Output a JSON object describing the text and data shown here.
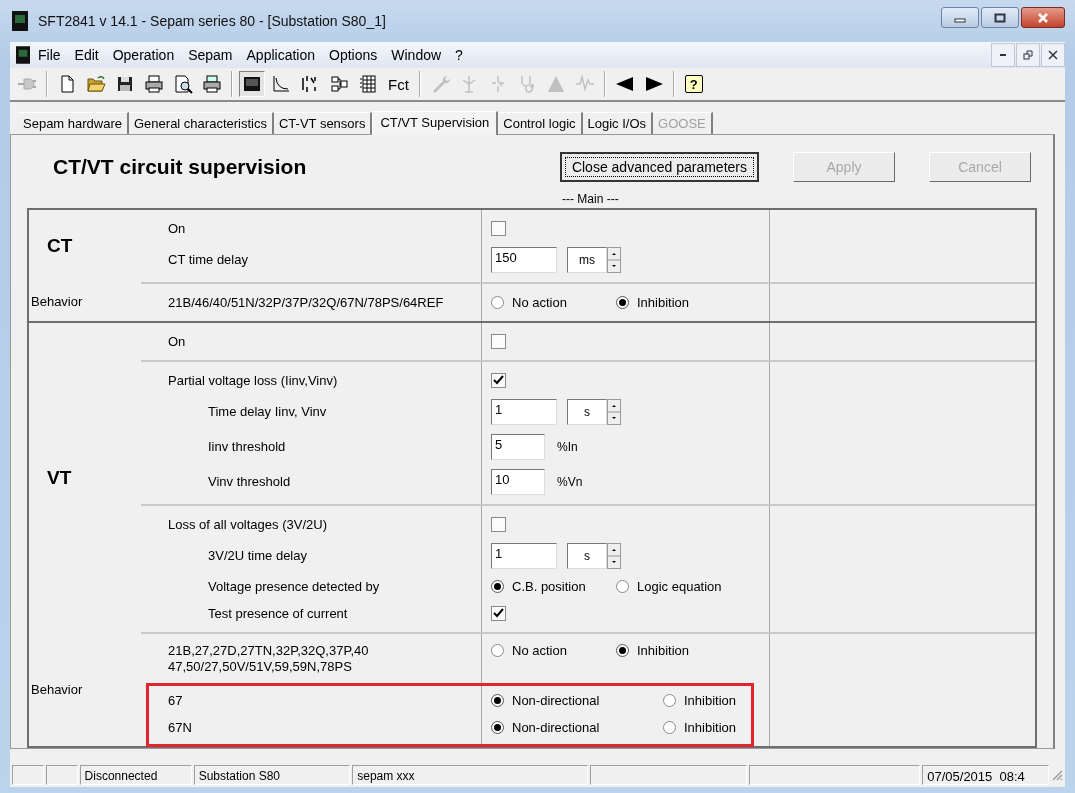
{
  "window": {
    "title": "SFT2841  v 14.1 - Sepam series 80 - [Substation S80_1]"
  },
  "menu": [
    {
      "label": "File"
    },
    {
      "label": "Edit"
    },
    {
      "label": "Operation"
    },
    {
      "label": "Sepam"
    },
    {
      "label": "Application"
    },
    {
      "label": "Options"
    },
    {
      "label": "Window"
    },
    {
      "label": "?"
    }
  ],
  "toolbar": [
    {
      "kind": "button",
      "disabled": true,
      "pressed": false
    },
    {
      "kind": "separator"
    },
    {
      "kind": "button",
      "disabled": false,
      "pressed": false
    },
    {
      "kind": "button",
      "disabled": false,
      "pressed": false
    },
    {
      "kind": "button",
      "disabled": false,
      "pressed": false
    },
    {
      "kind": "button",
      "disabled": false,
      "pressed": false
    },
    {
      "kind": "button",
      "disabled": false,
      "pressed": false
    },
    {
      "kind": "button",
      "disabled": false,
      "pressed": false
    },
    {
      "kind": "separator"
    },
    {
      "kind": "button",
      "disabled": false,
      "pressed": true
    },
    {
      "kind": "button",
      "disabled": false,
      "pressed": false
    },
    {
      "kind": "button",
      "disabled": false,
      "pressed": false
    },
    {
      "kind": "button",
      "disabled": false,
      "pressed": false
    },
    {
      "kind": "button",
      "disabled": false,
      "pressed": false
    },
    {
      "kind": "text",
      "label": "Fct",
      "disabled": false,
      "pressed": false
    },
    {
      "kind": "separator"
    },
    {
      "kind": "button",
      "disabled": true,
      "pressed": false
    },
    {
      "kind": "button",
      "disabled": true,
      "pressed": false
    },
    {
      "kind": "button",
      "disabled": true,
      "pressed": false
    },
    {
      "kind": "button",
      "disabled": true,
      "pressed": false
    },
    {
      "kind": "button",
      "disabled": true,
      "pressed": false
    },
    {
      "kind": "button",
      "disabled": true,
      "pressed": false
    },
    {
      "kind": "separator"
    },
    {
      "kind": "button",
      "disabled": false,
      "pressed": false
    },
    {
      "kind": "button",
      "disabled": false,
      "pressed": false
    },
    {
      "kind": "separator"
    },
    {
      "kind": "bubble",
      "label": "?",
      "disabled": false,
      "pressed": false
    }
  ],
  "tabs": [
    {
      "label": "Sepam hardware",
      "selected": false,
      "disabled": false
    },
    {
      "label": "General characteristics",
      "selected": false,
      "disabled": false
    },
    {
      "label": "CT-VT sensors",
      "selected": false,
      "disabled": false
    },
    {
      "label": "CT/VT Supervision",
      "selected": true,
      "disabled": false
    },
    {
      "label": "Control logic",
      "selected": false,
      "disabled": false
    },
    {
      "label": "Logic I/Os",
      "selected": false,
      "disabled": false
    },
    {
      "label": "GOOSE",
      "selected": false,
      "disabled": true
    }
  ],
  "page": {
    "title": "CT/VT circuit supervision",
    "buttons": [
      {
        "label": "Close advanced parameters",
        "disabled": false,
        "focused": true
      },
      {
        "label": "Apply",
        "disabled": true,
        "focused": false
      },
      {
        "label": "Cancel",
        "disabled": true,
        "focused": false
      }
    ],
    "caption": "--- Main ---"
  },
  "sections": [
    {
      "blocks": [
        {
          "kind": "main",
          "label": "CT",
          "groups": [
            {
              "rows": [
                {
                  "kind": "checkbox",
                  "label": "On",
                  "checked": false
                },
                {
                  "kind": "spin",
                  "label": "CT time delay",
                  "value": "150",
                  "unit": "ms"
                }
              ]
            }
          ]
        },
        {
          "kind": "sub",
          "label": "Behavior",
          "groups": [
            {
              "rows": [
                {
                  "kind": "radio",
                  "label": "21B/46/40/51N/32P/37P/32Q/67N/78PS/64REF",
                  "options": [
                    {
                      "label": "No action",
                      "selected": false
                    },
                    {
                      "label": "Inhibition",
                      "selected": true
                    }
                  ]
                }
              ]
            }
          ]
        }
      ]
    },
    {
      "blocks": [
        {
          "kind": "main",
          "label": "VT",
          "groups": [
            {
              "rows": [
                {
                  "kind": "checkbox",
                  "label": "On",
                  "checked": false
                }
              ]
            },
            {
              "rows": [
                {
                  "kind": "checkbox",
                  "label": "Partial voltage loss (Iinv,Vinv)",
                  "checked": true,
                  "children": [
                    {
                      "kind": "spin",
                      "label": "Time delay Iinv, Vinv",
                      "value": "1",
                      "unit": "s"
                    },
                    {
                      "kind": "number",
                      "label": "Iinv threshold",
                      "value": "5",
                      "unit": "%In"
                    },
                    {
                      "kind": "number",
                      "label": "Vinv threshold",
                      "value": "10",
                      "unit": "%Vn"
                    }
                  ]
                }
              ]
            },
            {
              "rows": [
                {
                  "kind": "checkbox",
                  "label": "Loss of all voltages (3V/2U)",
                  "checked": false,
                  "children": [
                    {
                      "kind": "spin",
                      "label": "3V/2U time delay",
                      "value": "1",
                      "unit": "s"
                    },
                    {
                      "kind": "radio",
                      "label": "Voltage presence detected by",
                      "options": [
                        {
                          "label": "C.B. position",
                          "selected": true
                        },
                        {
                          "label": "Logic equation",
                          "selected": false
                        }
                      ]
                    },
                    {
                      "kind": "checkbox",
                      "label": "Test presence of current",
                      "checked": true
                    }
                  ]
                }
              ]
            }
          ]
        },
        {
          "kind": "sub",
          "label": "Behavior",
          "groups": [
            {
              "rows": [
                {
                  "kind": "radio",
                  "lines": [
                    "21B,27,27D,27TN,32P,32Q,37P,40",
                    "47,50/27,50V/51V,59,59N,78PS"
                  ],
                  "options": [
                    {
                      "label": "No action",
                      "selected": false
                    },
                    {
                      "label": "Inhibition",
                      "selected": true
                    }
                  ]
                }
              ],
              "highlighted_rows": [
                {
                  "kind": "radio",
                  "label": "67",
                  "options": [
                    {
                      "label": "Non-directional",
                      "selected": true
                    },
                    {
                      "label": "Inhibition",
                      "selected": false
                    }
                  ]
                },
                {
                  "kind": "radio",
                  "label": "67N",
                  "options": [
                    {
                      "label": "Non-directional",
                      "selected": true
                    },
                    {
                      "label": "Inhibition",
                      "selected": false
                    }
                  ]
                }
              ]
            }
          ]
        }
      ]
    }
  ],
  "status_bar": {
    "panes": [
      "Disconnected",
      "Substation S80",
      "sepam xxx",
      "07/05/2015  08:4"
    ]
  }
}
